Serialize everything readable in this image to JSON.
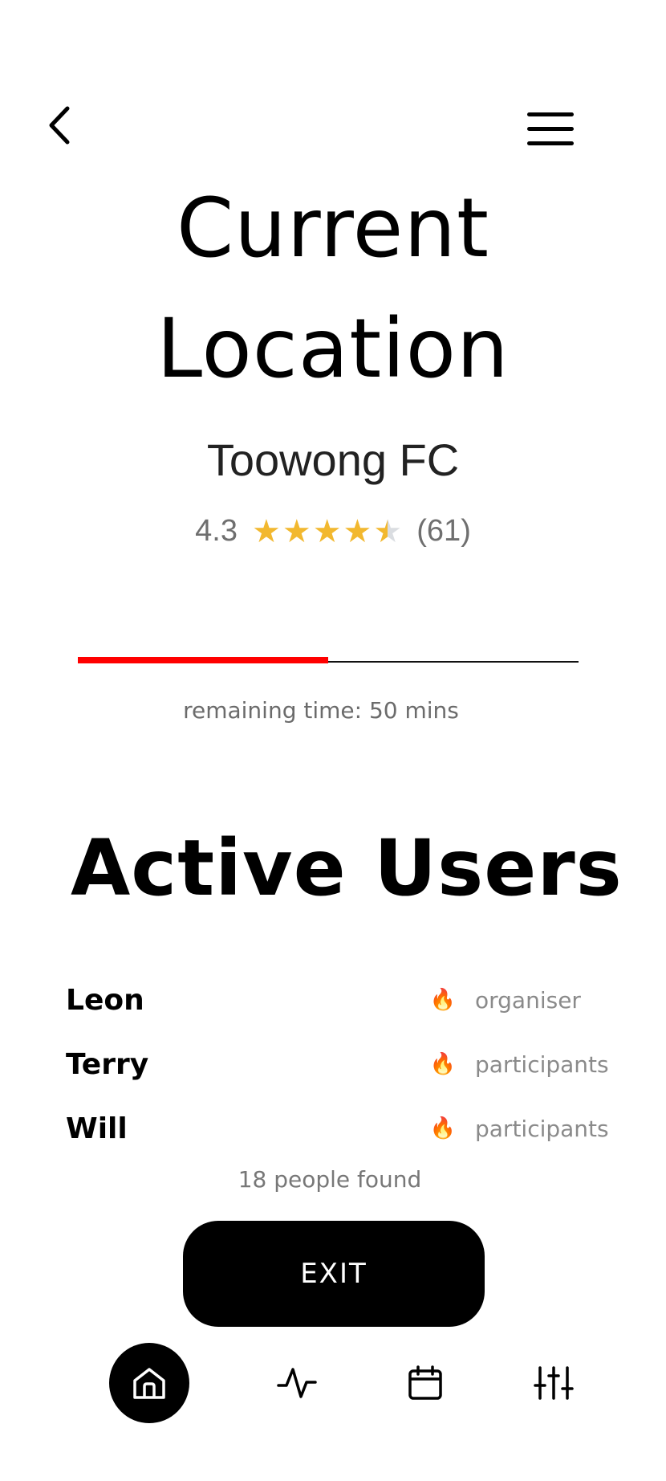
{
  "header": {
    "title_line1": "Current",
    "title_line2": "Location"
  },
  "place": {
    "name": "Toowong FC",
    "rating": "4.3",
    "rating_value": 4.3,
    "reviews": "(61)"
  },
  "session": {
    "progress_fraction": 0.5,
    "remaining_text": "remaining time: 50 mins"
  },
  "active_users": {
    "title": "Active Users",
    "users": [
      {
        "name": "Leon",
        "role": "organiser"
      },
      {
        "name": "Terry",
        "role": "participants"
      },
      {
        "name": "Will",
        "role": "participants"
      }
    ],
    "found_text": "18 people found"
  },
  "actions": {
    "exit_label": "EXIT"
  },
  "nav": {
    "items": [
      {
        "icon": "home-icon",
        "active": true
      },
      {
        "icon": "activity-icon",
        "active": false
      },
      {
        "icon": "calendar-icon",
        "active": false
      },
      {
        "icon": "sliders-icon",
        "active": false
      }
    ]
  },
  "colors": {
    "accent_progress": "#ff0000",
    "star": "#f2b82f",
    "primary": "#000000"
  }
}
